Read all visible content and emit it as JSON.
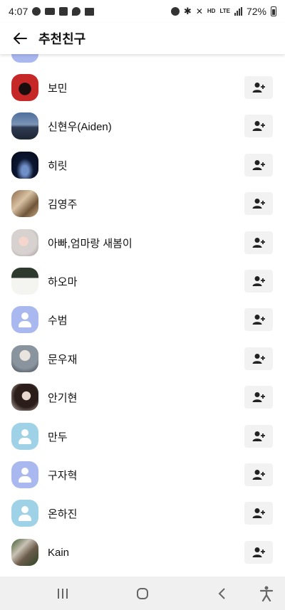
{
  "status_bar": {
    "time": "4:07",
    "battery": "72%",
    "network_hd": "HD",
    "network_lte": "LTE",
    "left_icons": [
      "settings-gear-icon",
      "mail-icon",
      "notification-icon",
      "chat-bubble-icon",
      "gallery-icon"
    ],
    "right_icons": [
      "alarm-icon",
      "bluetooth-icon",
      "vibrate-icon",
      "signal-icon",
      "battery-icon"
    ]
  },
  "header": {
    "title": "추천친구",
    "back_icon": "arrow-left-icon"
  },
  "friends": [
    {
      "name": "보민",
      "avatar": "photo-red"
    },
    {
      "name": "신현우(Aiden)",
      "avatar": "photo-landscape"
    },
    {
      "name": "히릿",
      "avatar": "photo-dark"
    },
    {
      "name": "김영주",
      "avatar": "photo-animals"
    },
    {
      "name": "아빠,엄마랑 새봄이",
      "avatar": "photo-child"
    },
    {
      "name": "하오마",
      "avatar": "photo-poster"
    },
    {
      "name": "수범",
      "avatar": "default-purple"
    },
    {
      "name": "문우재",
      "avatar": "photo-person"
    },
    {
      "name": "안기현",
      "avatar": "photo-woman"
    },
    {
      "name": "만두",
      "avatar": "default-teal"
    },
    {
      "name": "구자혁",
      "avatar": "default-purple"
    },
    {
      "name": "온하진",
      "avatar": "default-teal"
    },
    {
      "name": "Kain",
      "avatar": "photo-outdoor"
    }
  ],
  "add_friend_icon": "add-person-icon",
  "colors": {
    "default_purple": "#a9b8ee",
    "default_teal": "#9fd2e6",
    "button_bg": "#f2f2f2",
    "navbar_bg": "#f0f0f0"
  },
  "nav_bar": {
    "icons": [
      "recent-apps-icon",
      "home-icon",
      "back-icon",
      "accessibility-icon"
    ]
  }
}
